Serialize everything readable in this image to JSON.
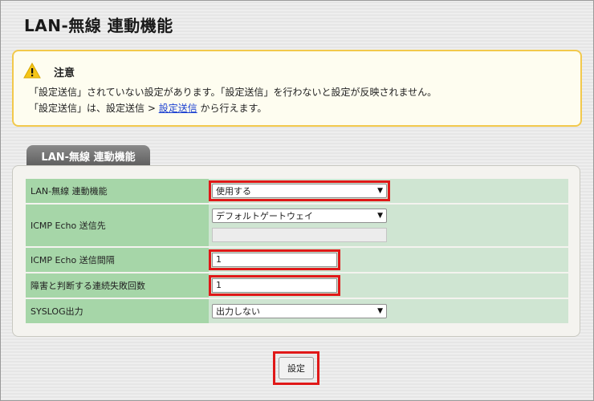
{
  "page": {
    "title": "LAN-無線 連動機能"
  },
  "warning": {
    "icon": "warning-icon",
    "title": "注意",
    "line1": "「設定送信」されていない設定があります。「設定送信」を行わないと設定が反映されません。",
    "line2_prefix": "「設定送信」は、設定送信 > ",
    "line2_link": "設定送信",
    "line2_suffix": " から行えます。"
  },
  "section": {
    "tab_label": "LAN-無線 連動機能"
  },
  "form": {
    "rows": [
      {
        "label": "LAN-無線 連動機能",
        "value": "使用する"
      },
      {
        "label": "ICMP Echo 送信先",
        "value": "デフォルトゲートウェイ",
        "sub_value": ""
      },
      {
        "label": "ICMP Echo 送信間隔",
        "value": "1"
      },
      {
        "label": "障害と判断する連続失敗回数",
        "value": "1"
      },
      {
        "label": "SYSLOG出力",
        "value": "出力しない"
      }
    ]
  },
  "submit": {
    "label": "設定"
  },
  "colors": {
    "highlight": "#e01818",
    "label_bg": "#a6d6a8",
    "control_bg": "#cfe5d2",
    "warning_border": "#f2c94c"
  }
}
